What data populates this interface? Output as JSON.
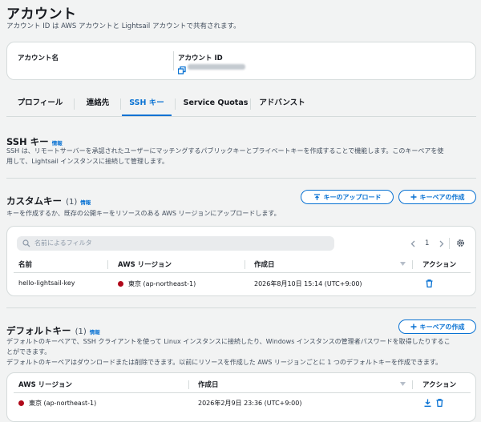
{
  "page": {
    "title": "アカウント",
    "subtitle": "アカウント ID は AWS アカウントと Lightsail アカウントで共有されます。"
  },
  "account_card": {
    "name_label": "アカウント名",
    "id_label": "アカウント ID"
  },
  "tabs": [
    {
      "label": "プロフィール",
      "active": false
    },
    {
      "label": "連絡先",
      "active": false
    },
    {
      "label": "SSH キー",
      "active": true
    },
    {
      "label": "Service Quotas",
      "active": false
    },
    {
      "label": "アドバンスト",
      "active": false
    }
  ],
  "ssh_section": {
    "title": "SSH キー",
    "info": "情報",
    "desc_line1": "SSH は、リモートサーバーを承認されたユーザーにマッチングするパブリックキーとプライベートキーを作成することで機能します。このキーペアを使",
    "desc_line2": "用して、Lightsail インスタンスに接続して管理します。"
  },
  "custom_keys": {
    "title": "カスタムキー",
    "count": "(1)",
    "info": "情報",
    "desc": "キーを作成するか、既存の公開キーをリソースのある AWS リージョンにアップロードします。",
    "upload_button": "キーのアップロード",
    "create_button": "キーペアの作成",
    "filter_placeholder": "名前によるフィルタ",
    "page_number": "1",
    "headers": {
      "name": "名前",
      "region": "AWS リージョン",
      "created": "作成日",
      "action": "アクション"
    },
    "rows": [
      {
        "name": "hello-lightsail-key",
        "region": "東京 (ap-northeast-1)",
        "created": "2026年8月10日 15:14 (UTC+9:00)"
      }
    ]
  },
  "default_keys": {
    "title": "デフォルトキー",
    "count": "(1)",
    "info": "情報",
    "desc_line1": "デフォルトのキーペアで、SSH クライアントを使って Linux インスタンスに接続したり、Windows インスタンスの管理者パスワードを取得したりするこ",
    "desc_line2": "とができます。",
    "desc_line3": "デフォルトのキーペアはダウンロードまたは削除できます。以前にリソースを作成した AWS リージョンごとに 1 つのデフォルトキーを作成できます。",
    "create_button": "キーペアの作成",
    "headers": {
      "region": "AWS リージョン",
      "created": "作成日",
      "action": "アクション"
    },
    "rows": [
      {
        "region": "東京 (ap-northeast-1)",
        "created": "2026年2月9日 23:36 (UTC+9:00)"
      }
    ]
  },
  "colors": {
    "accent": "#0972d3",
    "region_dot": "#b0081a"
  }
}
